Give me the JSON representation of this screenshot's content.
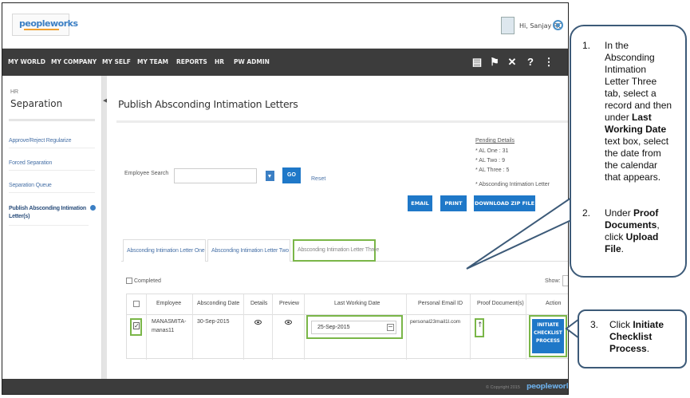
{
  "header": {
    "logo_text": "peopleworks",
    "greeting": "Hi, Sanjay RO"
  },
  "nav": {
    "items": [
      "MY WORLD",
      "MY COMPANY",
      "MY SELF",
      "MY TEAM",
      "REPORTS",
      "HR",
      "PW ADMIN"
    ],
    "icons": [
      "book-icon",
      "pin-icon",
      "tools-icon",
      "help-icon",
      "share-icon"
    ]
  },
  "sidebar": {
    "group": "HR",
    "title": "Separation",
    "items": [
      "Approve/Reject Regularize",
      "Forced Separation",
      "Separation Queue",
      "Publish Absconding Intimation Letter(s)"
    ],
    "active_index": 3
  },
  "main": {
    "title": "Publish Absconding Intimation Letters",
    "pending": {
      "title": "Pending Details",
      "lines": [
        "* AL One : 31",
        "* AL Two : 9",
        "* AL Three : 5",
        "* Absconding Intimation Letter"
      ]
    },
    "search": {
      "label": "Employee Search",
      "placeholder": "",
      "go_label": "GO",
      "reset_label": "Reset"
    },
    "buttons": {
      "email": "EMAIL",
      "print": "PRINT",
      "download": "DOWNLOAD ZIP FILE"
    },
    "tabs": [
      "Absconding Intimation Letter One",
      "Absconding Intimation Letter Two",
      "Absconding Intimation Letter Three"
    ],
    "selected_tab": 2,
    "completed_label": "Completed",
    "show_label": "Show:",
    "table": {
      "headers": [
        "Employee",
        "Absconding Date",
        "Details",
        "Preview",
        "Last Working Date",
        "Personal Email ID",
        "Proof Document(s)",
        "Action"
      ],
      "row": {
        "checked": true,
        "employee_line1": "MANASMITA-",
        "employee_line2": "manas11",
        "absconding_date": "30-Sep-2015",
        "last_working_date": "25-Sep-2015",
        "email": "personal23mail1l.com",
        "action_line1": "INITIATE",
        "action_line2": "CHECKLIST",
        "action_line3": "PROCESS"
      }
    }
  },
  "footer": {
    "copyright": "© Copyright 2015",
    "logo": "peopleworks"
  },
  "callout1": {
    "step1_num": "1.",
    "step1": {
      "a": "In the",
      "b": "Absconding",
      "c": "Intimation",
      "d": "Letter Three",
      "e": "tab, select a",
      "f": "record and then",
      "g": "under ",
      "g_bold": "Last",
      "h_bold": "Working Date",
      "i": "text box, select",
      "j": "the date from",
      "k": "the calendar",
      "l": "that appears."
    },
    "step2_num": "2.",
    "step2": {
      "a": "Under ",
      "a_bold": "Proof",
      "b_bold": "Documents",
      "b": ",",
      "c": "click ",
      "c_bold": "Upload",
      "d_bold": "File",
      "d": "."
    }
  },
  "callout2": {
    "step3_num": "3.",
    "step3": {
      "a": "Click ",
      "a_bold": "Initiate",
      "b_bold": "Checklist",
      "c_bold": "Process",
      "c": "."
    }
  },
  "colors": {
    "nav_bg": "#3c3c3c",
    "primary_blue": "#1f78c8",
    "highlight_green": "#7ab648",
    "callout_border": "#3c5a78"
  }
}
